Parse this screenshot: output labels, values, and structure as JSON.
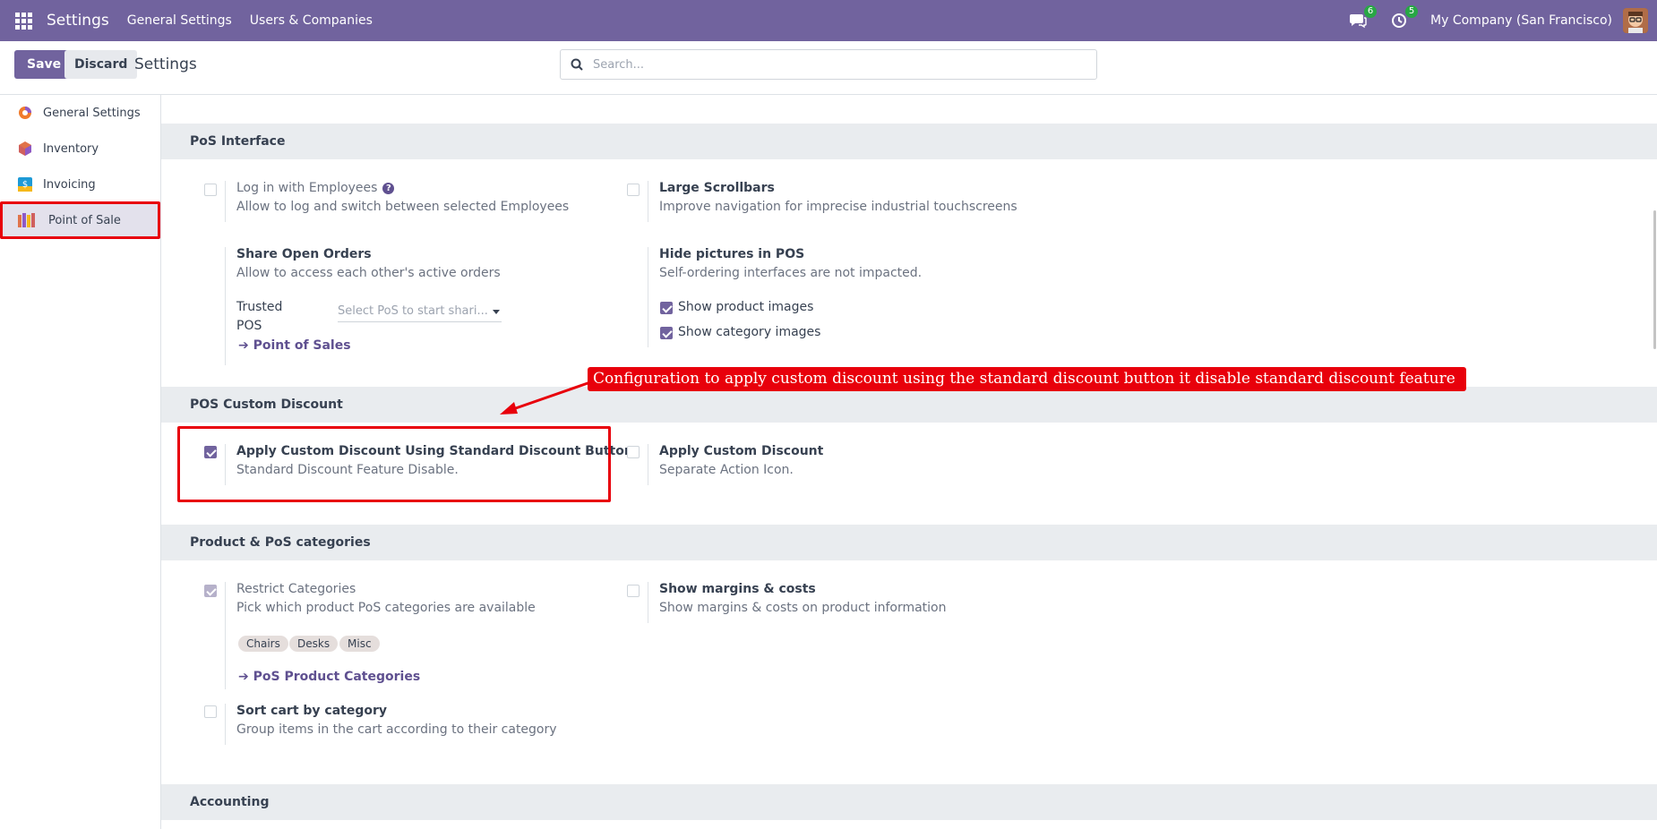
{
  "navbar": {
    "app_title": "Settings",
    "links": [
      "General Settings",
      "Users & Companies"
    ],
    "chat_badge": "6",
    "activity_badge": "5",
    "company": "My Company (San Francisco)"
  },
  "control": {
    "save_label": "Save",
    "discard_label": "Discard",
    "title": "Settings",
    "search_placeholder": "Search..."
  },
  "sidebar": {
    "items": [
      {
        "label": "General Settings",
        "icon": "odoo-settings-icon"
      },
      {
        "label": "Inventory",
        "icon": "inventory-cube-icon"
      },
      {
        "label": "Invoicing",
        "icon": "invoicing-icon"
      },
      {
        "label": "Point of Sale",
        "icon": "point-of-sale-icon",
        "active": true
      }
    ]
  },
  "pos_interface": {
    "heading": "PoS Interface",
    "login_employees": {
      "title": "Log in with Employees",
      "desc": "Allow to log and switch between selected Employees",
      "checked": false
    },
    "large_scrollbars": {
      "title": "Large Scrollbars",
      "desc": "Improve navigation for imprecise industrial touchscreens",
      "checked": false
    },
    "share_orders": {
      "title": "Share Open Orders",
      "desc": "Allow to access each other's active orders",
      "trusted_label_1": "Trusted",
      "trusted_label_2": "POS",
      "trusted_placeholder": "Select PoS to start shari...",
      "link": "Point of Sales"
    },
    "hide_pictures": {
      "title": "Hide pictures in POS",
      "desc": "Self-ordering interfaces are not impacted.",
      "show_product_images": "Show product images",
      "show_category_images": "Show category images"
    }
  },
  "pos_custom_discount": {
    "heading": "POS Custom Discount",
    "standard_button": {
      "title": "Apply Custom Discount Using Standard Discount Button",
      "desc": "Standard Discount Feature Disable.",
      "checked": true
    },
    "custom": {
      "title": "Apply Custom Discount",
      "desc": "Separate Action Icon.",
      "checked": false
    }
  },
  "product_categories": {
    "heading": "Product & PoS categories",
    "restrict": {
      "title": "Restrict Categories",
      "desc": "Pick which product PoS categories are available",
      "tags": [
        "Chairs",
        "Desks",
        "Misc"
      ],
      "link": "PoS Product Categories"
    },
    "margins": {
      "title": "Show margins & costs",
      "desc": "Show margins & costs on product information"
    },
    "sort_cart": {
      "title": "Sort cart by category",
      "desc": "Group items in the cart according to their category"
    }
  },
  "accounting": {
    "heading": "Accounting"
  },
  "annotation": {
    "text": "Configuration to apply custom discount using the standard discount button it disable standard discount feature",
    "color": "#e8000b"
  },
  "colors": {
    "brand": "#71639e",
    "section_bg": "#e9ecef",
    "link": "#5f5090"
  }
}
